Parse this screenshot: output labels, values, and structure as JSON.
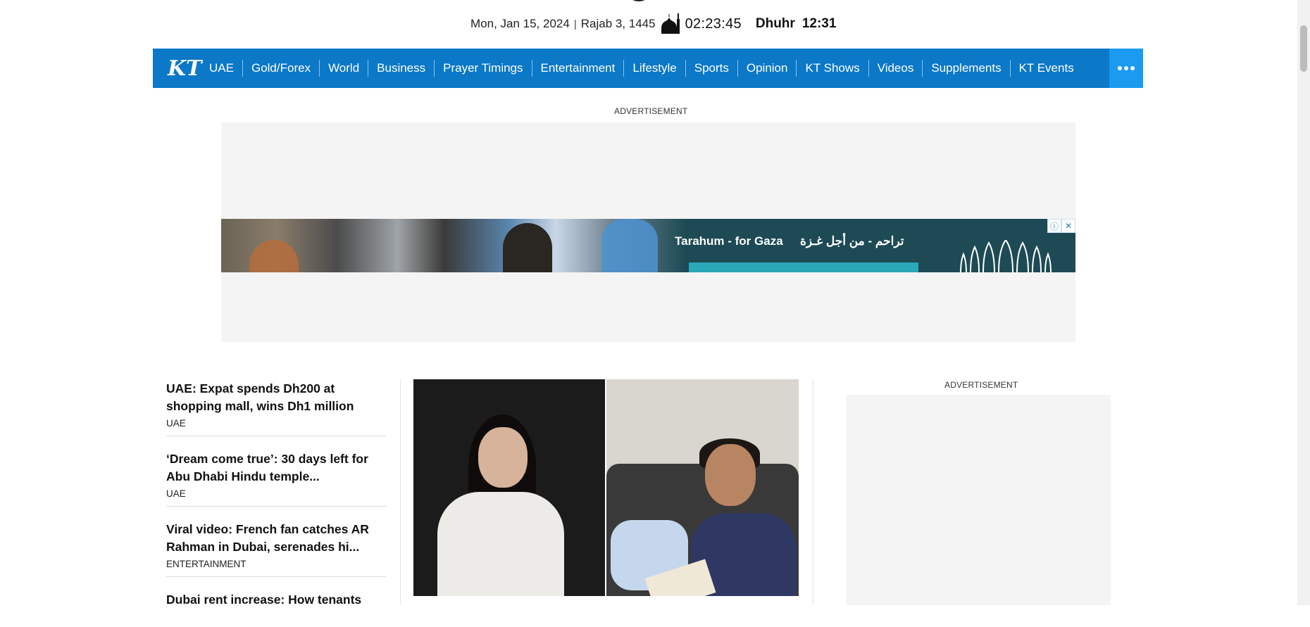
{
  "header": {
    "date": "Mon, Jan 15, 2024",
    "separator": "|",
    "hijri": "Rajab 3, 1445",
    "clock": "02:23:45",
    "prayer_name": "Dhuhr",
    "prayer_time": "12:31",
    "mosque_icon": "mosque-icon"
  },
  "nav": {
    "logo_text": "KT",
    "items": [
      "UAE",
      "Gold/Forex",
      "World",
      "Business",
      "Prayer Timings",
      "Entertainment",
      "Lifestyle",
      "Sports",
      "Opinion",
      "KT Shows",
      "Videos",
      "Supplements",
      "KT Events"
    ],
    "more_icon": "more-dots-icon",
    "color": "#0b78c8",
    "more_color": "#1a9bf0"
  },
  "ads": {
    "top_label": "ADVERTISEMENT",
    "side_label": "ADVERTISEMENT",
    "banner_en": "Tarahum - for Gaza",
    "banner_ar": "تراحم - من أجل غـزة",
    "info_icon": "ⓘ",
    "close_icon": "✕"
  },
  "stories": [
    {
      "headline": "UAE: Expat spends Dh200 at shopping mall, wins Dh1 million",
      "category": "UAE"
    },
    {
      "headline": "‘Dream come true’: 30 days left for Abu Dhabi Hindu temple...",
      "category": "UAE"
    },
    {
      "headline": "Viral video: French fan catches AR Rahman in Dubai, serenades hi...",
      "category": "ENTERTAINMENT"
    },
    {
      "headline": "Dubai rent increase: How tenants",
      "category": ""
    }
  ]
}
